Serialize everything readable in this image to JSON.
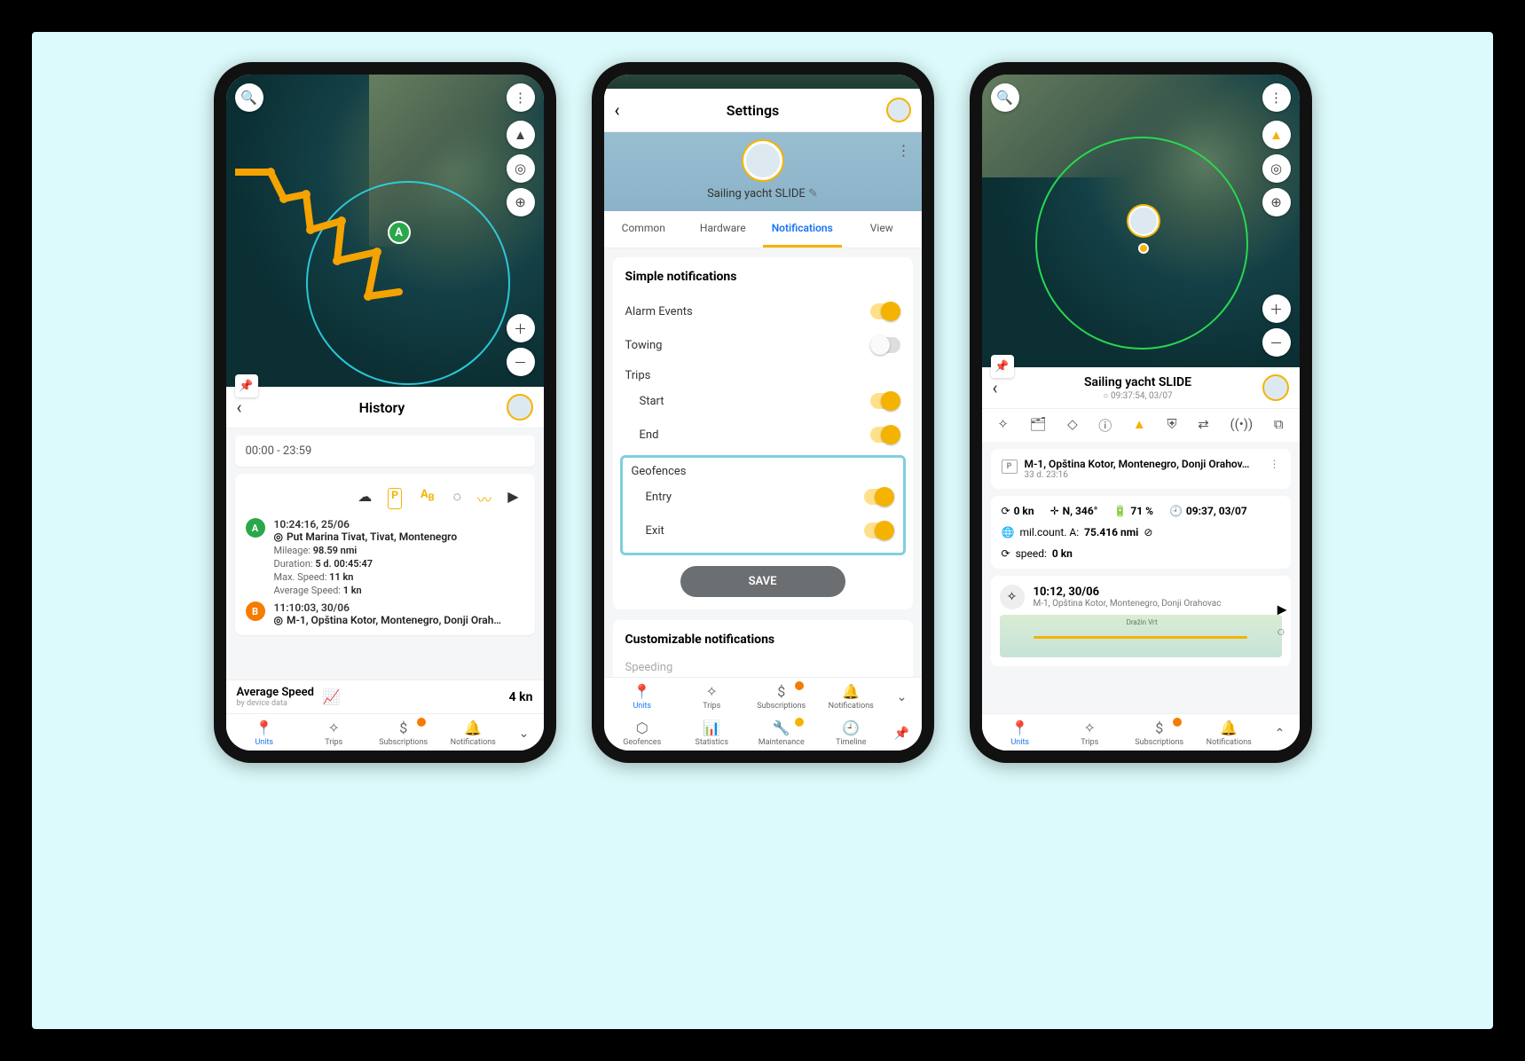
{
  "phone1": {
    "header": {
      "title": "History"
    },
    "timeRange": "00:00 - 23:59",
    "markerA": "A",
    "pointA": {
      "letter": "A",
      "timestamp": "10:24:16, 25/06",
      "location": "Put Marina Tivat, Tivat, Montenegro",
      "mileage_label": "Mileage:",
      "mileage_val": "98.59 nmi",
      "duration_label": "Duration:",
      "duration_val": "5 d. 00:45:47",
      "maxspeed_label": "Max. Speed:",
      "maxspeed_val": "11 kn",
      "avgspeed_label": "Average Speed:",
      "avgspeed_val": "1 kn"
    },
    "pointB": {
      "letter": "B",
      "timestamp": "11:10:03, 30/06",
      "location": "M-1, Opština Kotor, Montenegro, Donji Orah…"
    },
    "avg": {
      "label": "Average Speed",
      "sub": "by device data",
      "value": "4 kn"
    },
    "nav": {
      "units": "Units",
      "trips": "Trips",
      "subs": "Subscriptions",
      "notif": "Notifications"
    }
  },
  "phone2": {
    "title": "Settings",
    "unitName": "Sailing yacht SLIDE",
    "tabs": {
      "common": "Common",
      "hardware": "Hardware",
      "notifications": "Notifications",
      "view": "View"
    },
    "simple": {
      "heading": "Simple notifications",
      "alarm": "Alarm Events",
      "towing": "Towing",
      "trips": "Trips",
      "start": "Start",
      "end": "End",
      "geofences": "Geofences",
      "entry": "Entry",
      "exit": "Exit"
    },
    "save": "SAVE",
    "custom": {
      "heading": "Customizable notifications",
      "speeding": "Speeding"
    },
    "nav": {
      "units": "Units",
      "trips": "Trips",
      "subs": "Subscriptions",
      "notif": "Notifications",
      "geof": "Geofences",
      "stats": "Statistics",
      "maint": "Maintenance",
      "timeline": "Timeline"
    }
  },
  "phone3": {
    "header": {
      "title": "Sailing yacht SLIDE",
      "sub": "09:37:54, 03/07"
    },
    "loc": {
      "addr": "M-1, Opština Kotor, Montenegro, Donji Orahov…",
      "dur": "33 d. 23:16"
    },
    "metrics": {
      "speed": "0 kn",
      "heading": "N, 346°",
      "battery": "71 %",
      "datetime": "09:37, 03/07",
      "mileage_lbl": "mil.count. A:",
      "mileage_val": "75.416 nmi",
      "speed2_lbl": "speed:",
      "speed2_val": "0 kn"
    },
    "event": {
      "time": "10:12, 30/06",
      "loc": "M-1, Opština Kotor, Montenegro, Donji Orahovac",
      "maplabel": "Dražin Vrt"
    },
    "nav": {
      "units": "Units",
      "trips": "Trips",
      "subs": "Subscriptions",
      "notif": "Notifications"
    }
  }
}
